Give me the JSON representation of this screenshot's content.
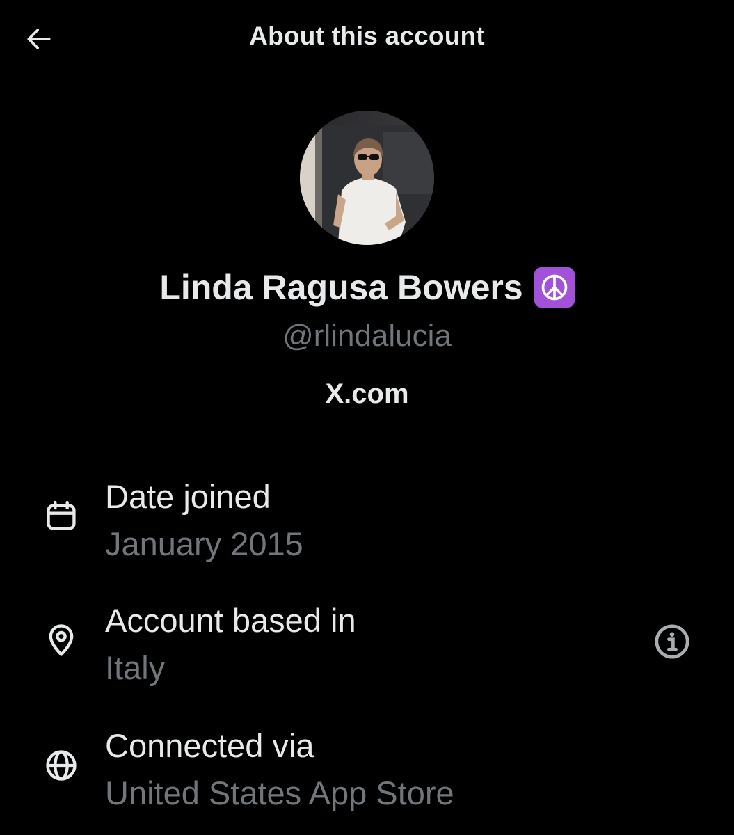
{
  "header": {
    "title": "About this account",
    "back_icon": "arrow-left-icon"
  },
  "profile": {
    "display_name": "Linda Ragusa Bowers",
    "badge_emoji": "☮",
    "badge_color": "#a152d9",
    "handle": "@rlindalucia",
    "source_domain": "X.com"
  },
  "details": [
    {
      "icon": "calendar-icon",
      "label": "Date joined",
      "value": "January 2015"
    },
    {
      "icon": "location-pin-icon",
      "label": "Account based in",
      "value": "Italy",
      "info_icon": "info-icon"
    },
    {
      "icon": "globe-icon",
      "label": "Connected via",
      "value": "United States App Store"
    }
  ],
  "colors": {
    "background": "#000000",
    "primary_text": "#e7e9ea",
    "secondary_text": "#71767b"
  }
}
